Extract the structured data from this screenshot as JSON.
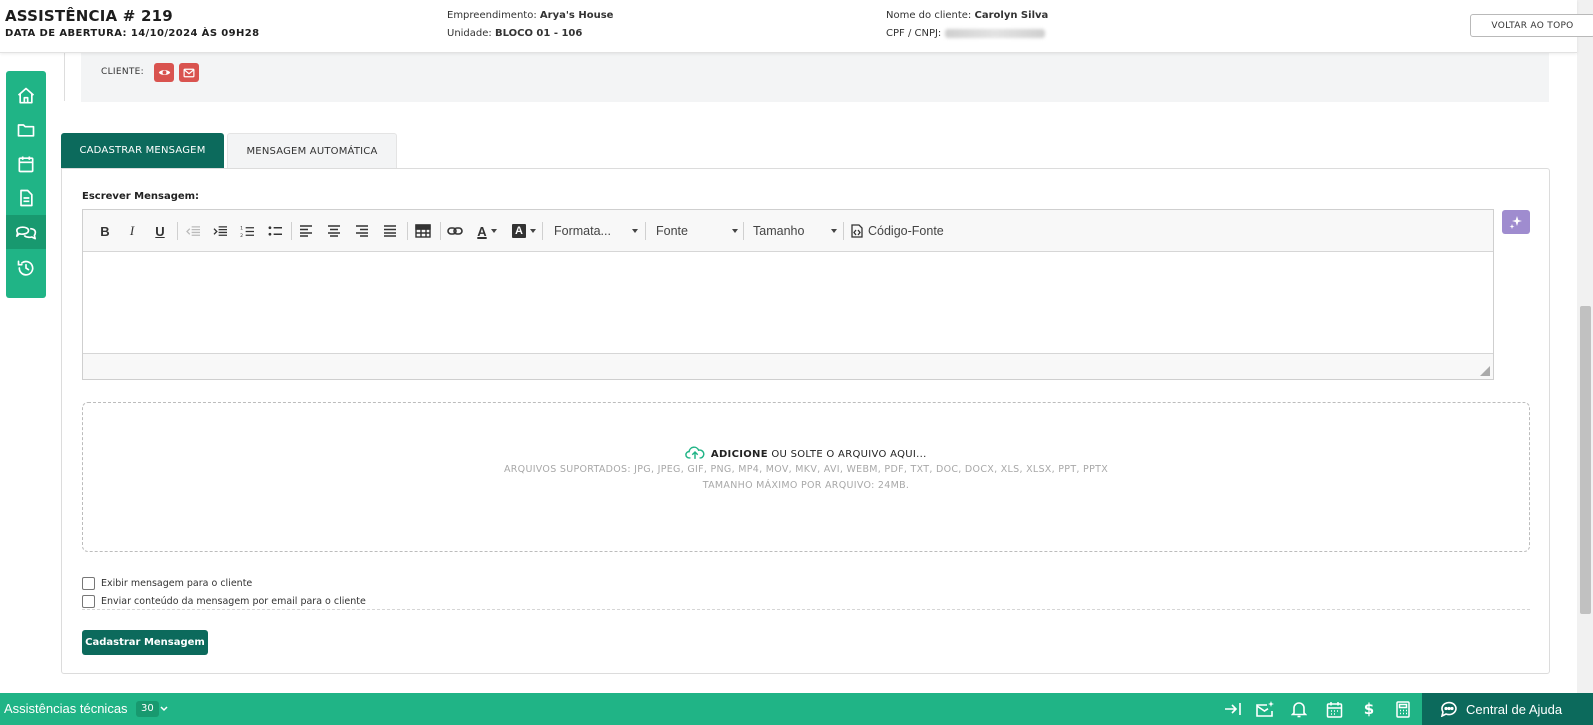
{
  "header": {
    "title": "ASSISTÊNCIA # 219",
    "opening_date": "DATA DE ABERTURA: 14/10/2024 ÀS 09H28",
    "development_label": "Empreendimento:",
    "development_value": "Arya's House",
    "unit_label": "Unidade:",
    "unit_value": "BLOCO 01 - 106",
    "client_name_label": "Nome do cliente:",
    "client_name_value": "Carolyn Silva",
    "cpf_label": "CPF / CNPJ:",
    "back_to_top": "VOLTAR AO TOPO"
  },
  "client_section": {
    "label": "CLIENTE:",
    "view_icon": "eye-icon",
    "email_icon": "envelope-icon"
  },
  "sidebar": {
    "items": [
      {
        "name": "home",
        "icon": "home-icon"
      },
      {
        "name": "folder",
        "icon": "folder-icon"
      },
      {
        "name": "calendar",
        "icon": "calendar-icon"
      },
      {
        "name": "document",
        "icon": "document-icon"
      },
      {
        "name": "messages",
        "icon": "chat-icon",
        "active": true
      },
      {
        "name": "history",
        "icon": "history-icon"
      }
    ]
  },
  "tabs": [
    {
      "label": "CADASTRAR MENSAGEM",
      "active": true
    },
    {
      "label": "MENSAGEM AUTOMÁTICA",
      "active": false
    }
  ],
  "editor": {
    "label": "Escrever Mensagem:",
    "bold": "B",
    "italic": "I",
    "underline": "U",
    "text_color": "A",
    "bg_color": "A",
    "format_dropdown": "Formata...",
    "font_dropdown": "Fonte",
    "size_dropdown": "Tamanho",
    "source_code": "Código-Fonte"
  },
  "dropzone": {
    "add": "ADICIONE",
    "drop_text": " OU SOLTE O ARQUIVO AQUI...",
    "supported": "ARQUIVOS SUPORTADOS: JPG, JPEG, GIF, PNG, MP4, MOV, MKV, AVI, WEBM, PDF, TXT, DOC, DOCX, XLS, XLSX, PPT, PPTX",
    "max_size": "TAMANHO MÁXIMO POR ARQUIVO: 24MB."
  },
  "options": {
    "show_to_client": "Exibir mensagem para o cliente",
    "send_email": "Enviar conteúdo da mensagem por email para o cliente"
  },
  "submit_label": "Cadastrar Mensagem",
  "bottombar": {
    "title": "Assistências técnicas",
    "count": "30",
    "help": "Central de Ajuda"
  },
  "colors": {
    "brand_green": "#20b486",
    "dark_green": "#0c6a5c",
    "danger": "#d9534f",
    "ai_purple": "#9f8ccf"
  }
}
